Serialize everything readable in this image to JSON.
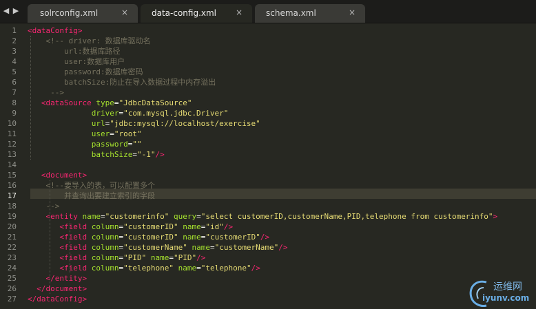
{
  "nav": {
    "left_arrow": "◀",
    "right_arrow": "▶"
  },
  "tabs": [
    {
      "label": "solrconfig.xml",
      "close": "×",
      "active": false
    },
    {
      "label": "data-config.xml",
      "close": "×",
      "active": true
    },
    {
      "label": "schema.xml",
      "close": "×",
      "active": false
    }
  ],
  "editor": {
    "current_line": 17,
    "line_numbers": [
      "1",
      "2",
      "3",
      "4",
      "5",
      "6",
      "7",
      "8",
      "9",
      "10",
      "11",
      "12",
      "13",
      "14",
      "15",
      "16",
      "17",
      "18",
      "19",
      "20",
      "21",
      "22",
      "23",
      "24",
      "25",
      "26",
      "27"
    ],
    "lines": [
      {
        "indent": "",
        "tokens": [
          [
            "t",
            "<"
          ],
          [
            "t",
            "dataConfig"
          ],
          [
            "t",
            ">"
          ]
        ]
      },
      {
        "indent": "    ",
        "tokens": [
          [
            "c",
            "<!-- driver: 数据库驱动名"
          ]
        ]
      },
      {
        "indent": "        ",
        "tokens": [
          [
            "c",
            "url:数据库路径"
          ]
        ]
      },
      {
        "indent": "        ",
        "tokens": [
          [
            "c",
            "user:数据库用户"
          ]
        ]
      },
      {
        "indent": "        ",
        "tokens": [
          [
            "c",
            "password:数据库密码"
          ]
        ]
      },
      {
        "indent": "        ",
        "tokens": [
          [
            "c",
            "batchSize:防止在导入数据过程中内存溢出"
          ]
        ]
      },
      {
        "indent": "     ",
        "tokens": [
          [
            "c",
            "-->"
          ]
        ]
      },
      {
        "indent": "   ",
        "tokens": [
          [
            "t",
            "<dataSource"
          ],
          [
            "p",
            " "
          ],
          [
            "a",
            "type"
          ],
          [
            "p",
            "="
          ],
          [
            "s",
            "\"JdbcDataSource\""
          ]
        ]
      },
      {
        "indent": "              ",
        "tokens": [
          [
            "a",
            "driver"
          ],
          [
            "p",
            "="
          ],
          [
            "s",
            "\"com.mysql.jdbc.Driver\""
          ]
        ]
      },
      {
        "indent": "              ",
        "tokens": [
          [
            "a",
            "url"
          ],
          [
            "p",
            "="
          ],
          [
            "s",
            "\"jdbc:mysql://localhost/exercise\""
          ]
        ]
      },
      {
        "indent": "              ",
        "tokens": [
          [
            "a",
            "user"
          ],
          [
            "p",
            "="
          ],
          [
            "s",
            "\"root\""
          ]
        ]
      },
      {
        "indent": "              ",
        "tokens": [
          [
            "a",
            "password"
          ],
          [
            "p",
            "="
          ],
          [
            "s",
            "\"\""
          ]
        ]
      },
      {
        "indent": "              ",
        "tokens": [
          [
            "a",
            "batchSize"
          ],
          [
            "p",
            "="
          ],
          [
            "s",
            "\"-1\""
          ],
          [
            "t",
            "/>"
          ]
        ]
      },
      {
        "indent": "",
        "tokens": []
      },
      {
        "indent": "   ",
        "tokens": [
          [
            "t",
            "<document>"
          ]
        ]
      },
      {
        "indent": "    ",
        "tokens": [
          [
            "c",
            "<!--要导入的表，可以配置多个"
          ]
        ]
      },
      {
        "indent": "        ",
        "tokens": [
          [
            "c",
            "并查询出要建立索引的字段"
          ]
        ]
      },
      {
        "indent": "    ",
        "tokens": [
          [
            "c",
            "-->"
          ]
        ]
      },
      {
        "indent": "    ",
        "tokens": [
          [
            "t",
            "<entity"
          ],
          [
            "p",
            " "
          ],
          [
            "a",
            "name"
          ],
          [
            "p",
            "="
          ],
          [
            "s",
            "\"customerinfo\""
          ],
          [
            "p",
            " "
          ],
          [
            "a",
            "query"
          ],
          [
            "p",
            "="
          ],
          [
            "s",
            "\"select customerID,customerName,PID,telephone from customerinfo\""
          ],
          [
            "t",
            ">"
          ]
        ]
      },
      {
        "indent": "       ",
        "tokens": [
          [
            "t",
            "<field"
          ],
          [
            "p",
            " "
          ],
          [
            "a",
            "column"
          ],
          [
            "p",
            "="
          ],
          [
            "s",
            "\"customerID\""
          ],
          [
            "p",
            " "
          ],
          [
            "a",
            "name"
          ],
          [
            "p",
            "="
          ],
          [
            "s",
            "\"id\""
          ],
          [
            "t",
            "/>"
          ]
        ]
      },
      {
        "indent": "       ",
        "tokens": [
          [
            "t",
            "<field"
          ],
          [
            "p",
            " "
          ],
          [
            "a",
            "column"
          ],
          [
            "p",
            "="
          ],
          [
            "s",
            "\"customerID\""
          ],
          [
            "p",
            " "
          ],
          [
            "a",
            "name"
          ],
          [
            "p",
            "="
          ],
          [
            "s",
            "\"customerID\""
          ],
          [
            "t",
            "/>"
          ]
        ]
      },
      {
        "indent": "       ",
        "tokens": [
          [
            "t",
            "<field"
          ],
          [
            "p",
            " "
          ],
          [
            "a",
            "column"
          ],
          [
            "p",
            "="
          ],
          [
            "s",
            "\"customerName\""
          ],
          [
            "p",
            " "
          ],
          [
            "a",
            "name"
          ],
          [
            "p",
            "="
          ],
          [
            "s",
            "\"customerName\""
          ],
          [
            "t",
            "/>"
          ]
        ]
      },
      {
        "indent": "       ",
        "tokens": [
          [
            "t",
            "<field"
          ],
          [
            "p",
            " "
          ],
          [
            "a",
            "column"
          ],
          [
            "p",
            "="
          ],
          [
            "s",
            "\"PID\""
          ],
          [
            "p",
            " "
          ],
          [
            "a",
            "name"
          ],
          [
            "p",
            "="
          ],
          [
            "s",
            "\"PID\""
          ],
          [
            "t",
            "/>"
          ]
        ]
      },
      {
        "indent": "       ",
        "tokens": [
          [
            "t",
            "<field"
          ],
          [
            "p",
            " "
          ],
          [
            "a",
            "column"
          ],
          [
            "p",
            "="
          ],
          [
            "s",
            "\"telephone\""
          ],
          [
            "p",
            " "
          ],
          [
            "a",
            "name"
          ],
          [
            "p",
            "="
          ],
          [
            "s",
            "\"telephone\""
          ],
          [
            "t",
            "/>"
          ]
        ]
      },
      {
        "indent": "    ",
        "tokens": [
          [
            "t",
            "</entity>"
          ]
        ]
      },
      {
        "indent": "  ",
        "tokens": [
          [
            "t",
            "</document>"
          ]
        ]
      },
      {
        "indent": "",
        "tokens": [
          [
            "t",
            "</dataConfig>"
          ]
        ]
      }
    ]
  },
  "watermark": {
    "cn": "运维网",
    "url": "iyunv.com"
  },
  "colors": {
    "background": "#272822",
    "tag": "#f92672",
    "attribute": "#a6e22e",
    "string": "#e6db74",
    "comment": "#75715e"
  }
}
